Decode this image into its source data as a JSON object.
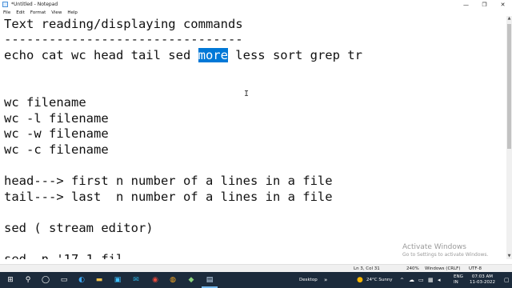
{
  "window": {
    "title": "*Untitled - Notepad",
    "minimize": "—",
    "maximize": "❐",
    "close": "✕"
  },
  "menu": [
    "File",
    "Edit",
    "Format",
    "View",
    "Help"
  ],
  "editor": {
    "line1": "Text reading/displaying commands",
    "line2": "--------------------------------",
    "line3_before": "echo cat wc head tail sed ",
    "line3_selected": "more",
    "line3_after": " less sort grep tr",
    "line4": "",
    "line5": "",
    "line6": "wc filename",
    "line7": "wc -l filename",
    "line8": "wc -w filename",
    "line9": "wc -c filename",
    "line10": "",
    "line11": "head---> first n number of a lines in a file",
    "line12": "tail---> last  n number of a lines in a file",
    "line13": "",
    "line14": "sed ( stream editor)",
    "line15": "",
    "line16": "sed -n '17,1 fil..."
  },
  "watermark": {
    "line1": "Activate Windows",
    "line2": "Go to Settings to activate Windows."
  },
  "status": {
    "position": "Ln 3, Col 31",
    "zoom": "240%",
    "line_ending": "Windows (CRLF)",
    "encoding": "UTF-8"
  },
  "taskbar": {
    "desktop_label": "Desktop",
    "weather": "24°C  Sunny",
    "language": "ENG\nIN",
    "time": "07:03 AM",
    "date": "11-03-2022"
  },
  "colors": {
    "selection": "#0078d7",
    "taskbar": "#1c2b3c"
  }
}
